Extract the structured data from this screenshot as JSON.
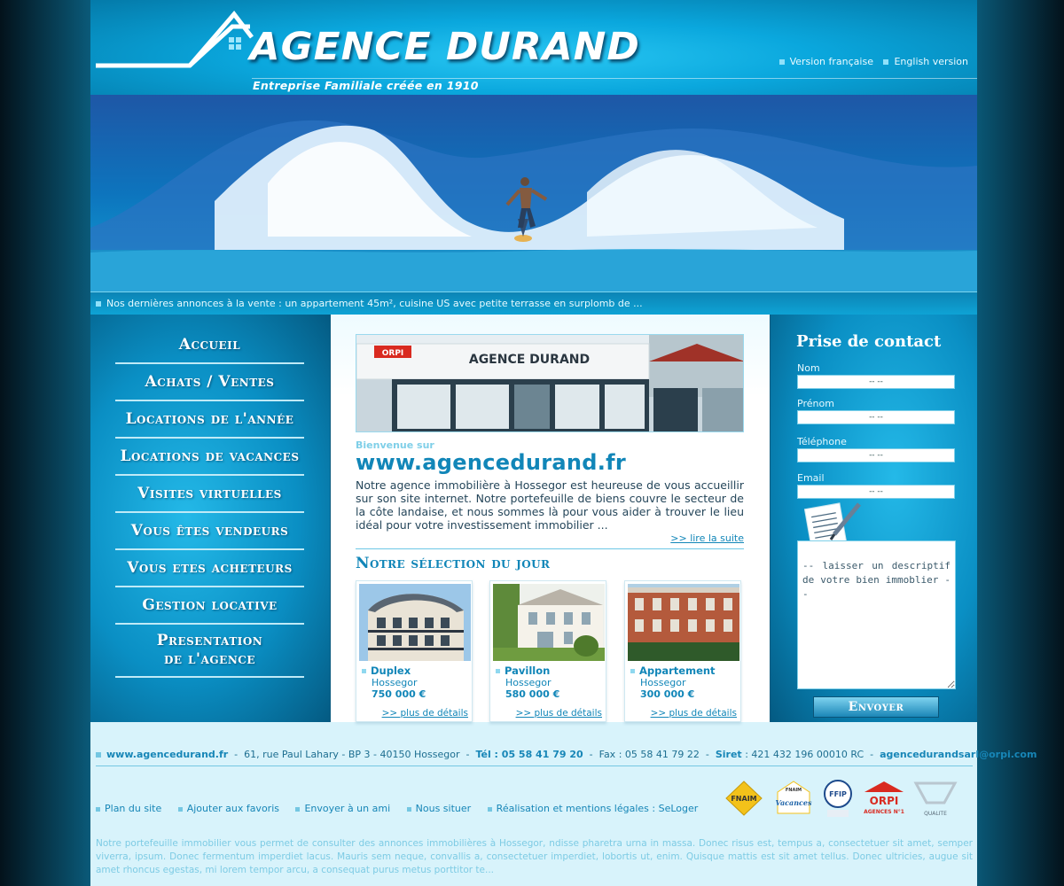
{
  "header": {
    "brand": "AGENCE DURAND",
    "tagline": "Entreprise Familiale créée en 1910",
    "lang_fr": "Version française",
    "lang_en": "English version"
  },
  "ticker": "Nos dernières annonces à la vente : un appartement 45m², cuisine US avec petite terrasse en surplomb de ...",
  "nav": [
    "Accueil",
    "Achats / Ventes",
    "Locations de l'année",
    "Locations de vacances",
    "Visites virtuelles",
    "Vous êtes vendeurs",
    "Vous etes acheteurs",
    "Gestion locative",
    "Presentation de l'agence"
  ],
  "nav_lines": {
    "presentation_1": "Presentation",
    "presentation_2": "de l'agence"
  },
  "main": {
    "shop_sign": "AGENCE DURAND",
    "shop_brand": "ORPI",
    "welcome_small": "Bienvenue sur",
    "welcome_big": "www.agencedurand.fr",
    "intro": "Notre agence immobilière à Hossegor est heureuse de vous accueillir sur son site internet. Notre portefeuille de biens couvre le secteur de la côte landaise, et nous sommes là pour vous aider à trouver le lieu idéal pour votre investissement immobilier ...",
    "read_more": ">> lire la suite",
    "selection_title": "Notre sélection du jour",
    "listings": [
      {
        "type": "Duplex",
        "city": "Hossegor",
        "price": "750 000 €",
        "details": ">> plus de détails"
      },
      {
        "type": "Pavillon",
        "city": "Hossegor",
        "price": "580 000 €",
        "details": ">> plus de détails"
      },
      {
        "type": "Appartement",
        "city": "Hossegor",
        "price": "300 000 €",
        "details": ">> plus de détails"
      }
    ]
  },
  "contact": {
    "title": "Prise de contact",
    "fields": [
      {
        "label": "Nom",
        "value": "-- --"
      },
      {
        "label": "Prénom",
        "value": "-- --"
      },
      {
        "label": "Téléphone",
        "value": "-- --"
      },
      {
        "label": "Email",
        "value": "-- --"
      }
    ],
    "description": "-- laisser un descriptif de votre bien immoblier --",
    "send": "Envoyer"
  },
  "footer": {
    "site": "www.agencedurand.fr",
    "address": "61, rue Paul Lahary - BP 3 -  40150 Hossegor",
    "tel_label": "Tél : 05 58 41 79 20",
    "fax": "Fax : 05 58 41 79 22",
    "siret_label": "Siret",
    "siret": ": 421 432 196 00010 RC",
    "email": "agencedurandsarl@orpi.com",
    "links": [
      "Plan du site",
      "Ajouter aux favoris",
      "Envoyer à un ami",
      "Nous situer",
      "Réalisation et mentions légales : SeLoger"
    ],
    "logos": [
      "FNAIM",
      "FNAIM Vacances",
      "FFIP",
      "ORPI",
      "AGENCES N°1",
      "QUALITE"
    ],
    "text": "Notre portefeuille immobilier vous permet de consulter des annonces immobilières à  Hossegor, ndisse pharetra urna in massa. Donec risus est, tempus a, consectetuer sit amet, semper viverra, ipsum. Donec fermentum imperdiet lacus. Mauris sem neque, convallis a, consectetuer imperdiet, lobortis ut, enim. Quisque mattis est sit amet tellus. Donec ultricies, augue sit amet rhoncus egestas, mi lorem tempor arcu, a consequat purus metus porttitor te..."
  }
}
